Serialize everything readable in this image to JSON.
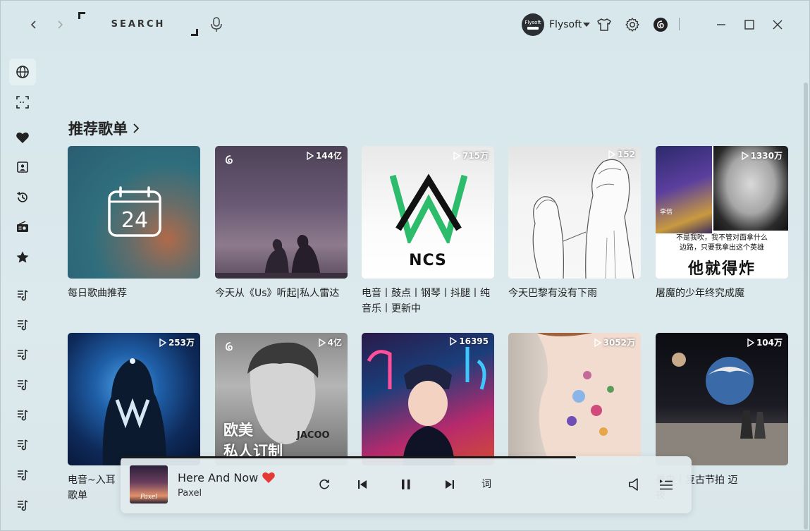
{
  "header": {
    "search_placeholder": "SEARCH",
    "user": {
      "avatar_text": "Flysoft",
      "name": "Flysoft"
    }
  },
  "section": {
    "title": "推荐歌单"
  },
  "playlists": [
    {
      "title": "每日歌曲推荐",
      "count": "",
      "date": "24"
    },
    {
      "title": "今天从《Us》听起|私人雷达",
      "count": "144亿"
    },
    {
      "title": "电音丨鼓点丨钢琴丨抖腿丨纯音乐丨更新中",
      "count": "715万",
      "cover_text": "NCS"
    },
    {
      "title": "今天巴黎有没有下雨",
      "count": "152"
    },
    {
      "title": "屠魔的少年终究成魔",
      "count": "1330万",
      "cover_caption_1": "不是我吹，我不管对面拿什么",
      "cover_caption_2": "边路，只要我拿出这个英雄",
      "cover_caption_3": "他就得炸",
      "cover_tag": "李信"
    },
    {
      "title": "电音~入耳",
      "title2": "歌单",
      "count": "253万"
    },
    {
      "title": "",
      "count": "4亿",
      "cover_text_1": "欧美",
      "cover_text_2": "私人订制",
      "cover_brand": "JACOO"
    },
    {
      "title": "",
      "count": "16395"
    },
    {
      "title": "",
      "count": "3052万"
    },
    {
      "title": "曼史丨复古节拍 迈",
      "title2": "夜",
      "count": "104万"
    }
  ],
  "player": {
    "title": "Here And Now",
    "artist": "Paxel",
    "art_text": "Paxel",
    "lyric_label": "词",
    "progress": 0.797
  },
  "colors": {
    "heart": "#e53935",
    "accent": "#1db954"
  }
}
